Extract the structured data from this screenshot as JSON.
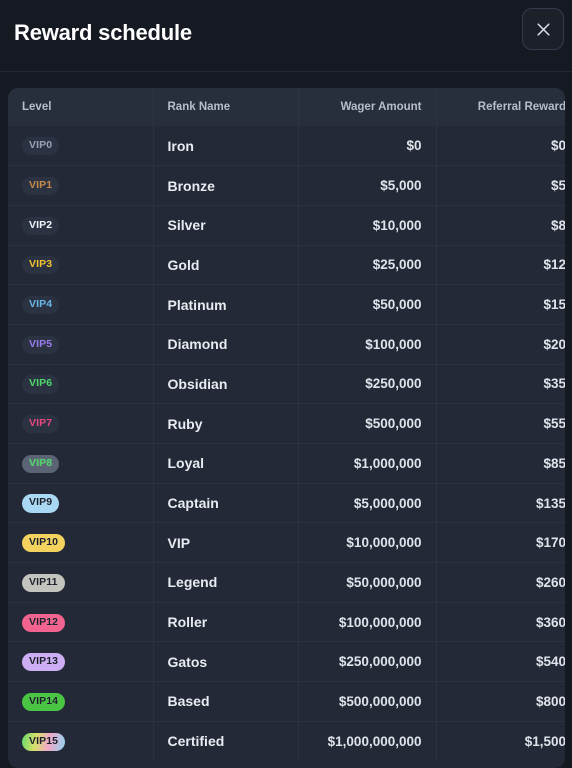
{
  "header": {
    "title": "Reward schedule",
    "close_label": "×",
    "close_icon": "close-icon"
  },
  "table": {
    "columns": [
      "Level",
      "Rank Name",
      "Wager Amount",
      "Referral Reward"
    ],
    "rows": [
      {
        "level": "VIP0",
        "rank": "Iron",
        "wager": "$0",
        "referral": "$0",
        "badge_style": "dark",
        "badge_bg": "#2b3342",
        "badge_fg": "#9aa3b5"
      },
      {
        "level": "VIP1",
        "rank": "Bronze",
        "wager": "$5,000",
        "referral": "$5",
        "badge_style": "dark",
        "badge_bg": "#2b3342",
        "badge_fg": "#c88a4a"
      },
      {
        "level": "VIP2",
        "rank": "Silver",
        "wager": "$10,000",
        "referral": "$8",
        "badge_style": "dark",
        "badge_bg": "#2b3342",
        "badge_fg": "#f2f5fa"
      },
      {
        "level": "VIP3",
        "rank": "Gold",
        "wager": "$25,000",
        "referral": "$12",
        "badge_style": "dark",
        "badge_bg": "#2b3342",
        "badge_fg": "#f2c230"
      },
      {
        "level": "VIP4",
        "rank": "Platinum",
        "wager": "$50,000",
        "referral": "$15",
        "badge_style": "dark",
        "badge_bg": "#2b3342",
        "badge_fg": "#69b6e8"
      },
      {
        "level": "VIP5",
        "rank": "Diamond",
        "wager": "$100,000",
        "referral": "$20",
        "badge_style": "dark",
        "badge_bg": "#2b3342",
        "badge_fg": "#9b7cf0"
      },
      {
        "level": "VIP6",
        "rank": "Obsidian",
        "wager": "$250,000",
        "referral": "$35",
        "badge_style": "dark",
        "badge_bg": "#2b3342",
        "badge_fg": "#4ed86a"
      },
      {
        "level": "VIP7",
        "rank": "Ruby",
        "wager": "$500,000",
        "referral": "$55",
        "badge_style": "dark",
        "badge_bg": "#2b3342",
        "badge_fg": "#e8477f"
      },
      {
        "level": "VIP8",
        "rank": "Loyal",
        "wager": "$1,000,000",
        "referral": "$85",
        "badge_style": "fill",
        "badge_bg": "#5a6475",
        "badge_fg": "#4ed86a"
      },
      {
        "level": "VIP9",
        "rank": "Captain",
        "wager": "$5,000,000",
        "referral": "$135",
        "badge_style": "fill",
        "badge_bg": "#a9d9f2",
        "badge_fg": "#1a1f29"
      },
      {
        "level": "VIP10",
        "rank": "VIP",
        "wager": "$10,000,000",
        "referral": "$170",
        "badge_style": "fill",
        "badge_bg": "#f3d35e",
        "badge_fg": "#1a1f29"
      },
      {
        "level": "VIP11",
        "rank": "Legend",
        "wager": "$50,000,000",
        "referral": "$260",
        "badge_style": "fill",
        "badge_bg": "#c3c4bd",
        "badge_fg": "#1a1f29"
      },
      {
        "level": "VIP12",
        "rank": "Roller",
        "wager": "$100,000,000",
        "referral": "$360",
        "badge_style": "fill",
        "badge_bg": "#f2638f",
        "badge_fg": "#1a1f29"
      },
      {
        "level": "VIP13",
        "rank": "Gatos",
        "wager": "$250,000,000",
        "referral": "$540",
        "badge_style": "fill",
        "badge_bg": "#cdaef5",
        "badge_fg": "#1a1f29"
      },
      {
        "level": "VIP14",
        "rank": "Based",
        "wager": "$500,000,000",
        "referral": "$800",
        "badge_style": "fill",
        "badge_bg": "#49c443",
        "badge_fg": "#1a1f29"
      },
      {
        "level": "VIP15",
        "rank": "Certified",
        "wager": "$1,000,000,000",
        "referral": "$1,500",
        "badge_style": "rainbow",
        "badge_bg": "linear-gradient(100deg,#63d86a 0%,#d8e06a 32%,#f0a8c8 62%,#8fd4f0 100%)",
        "badge_fg": "#1a1f29"
      }
    ]
  },
  "colors": {
    "page_bg": "#151922",
    "table_bg": "#232936",
    "header_row_bg": "#272e3c",
    "divider": "#2b3240",
    "text_primary": "#e8ebf1",
    "text_muted": "#b6bdcc"
  }
}
